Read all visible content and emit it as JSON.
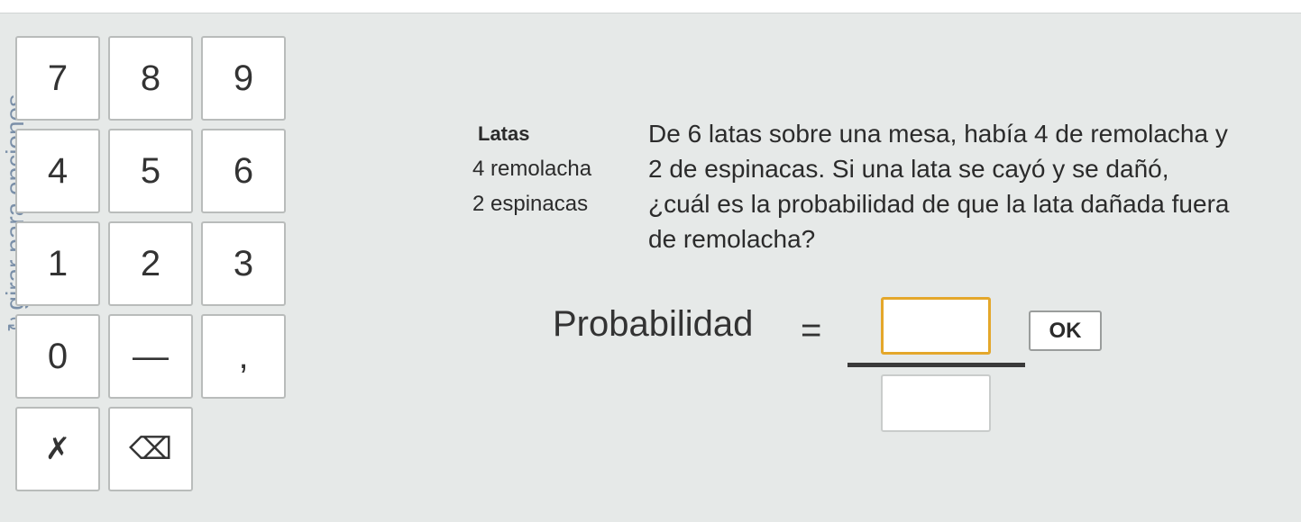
{
  "sidebar": {
    "rotate_label": "girar para opciones",
    "rotate_icon": "↻"
  },
  "keypad": {
    "k7": "7",
    "k8": "8",
    "k9": "9",
    "k4": "4",
    "k5": "5",
    "k6": "6",
    "k1": "1",
    "k2": "2",
    "k3": "3",
    "k0": "0",
    "minus": "—",
    "comma": ",",
    "clear": "✗",
    "backspace": "⌫"
  },
  "table": {
    "header": "Latas",
    "rows": [
      "4 remolacha",
      "2 espinacas"
    ]
  },
  "question": "De 6 latas sobre una mesa, había 4 de remolacha y 2 de espinacas. Si una lata se cayó y se dañó, ¿cuál es la probabilidad de que la lata dañada fuera de remolacha?",
  "answer": {
    "label": "Probabilidad",
    "equals": "=",
    "numerator": "",
    "denominator": "",
    "ok_label": "OK"
  },
  "colors": {
    "panel_bg": "#e6e9e8",
    "focus_border": "#e4a72b",
    "rotate_text": "#7a8fa8"
  }
}
